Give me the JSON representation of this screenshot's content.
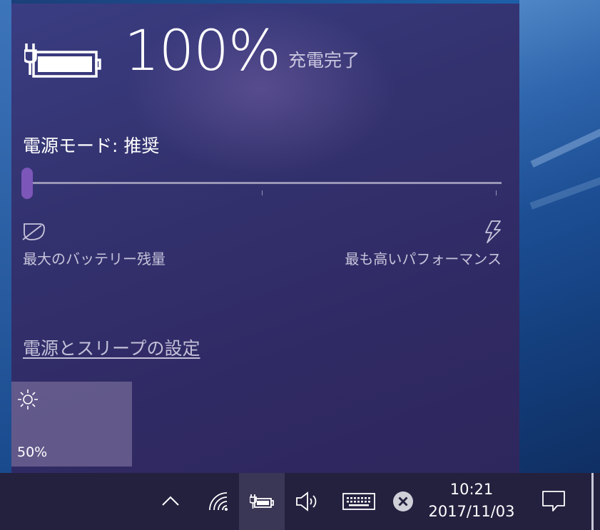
{
  "battery": {
    "percent_text": "100%",
    "status_text": "充電完了",
    "level": 1.0,
    "icon": "battery-charging-icon"
  },
  "power_mode": {
    "label": "電源モード: 推奨",
    "slider_position": 0,
    "left_icon": "leaf-icon",
    "left_label": "最大のバッテリー残量",
    "right_icon": "lightning-bolt-icon",
    "right_label": "最も高いパフォーマンス"
  },
  "settings_link": "電源とスリープの設定",
  "brightness_tile": {
    "icon": "sun-icon",
    "value": "50%"
  },
  "taskbar": {
    "icons": [
      "chevron-up-icon",
      "wifi-icon",
      "battery-plug-icon",
      "speaker-icon",
      "keyboard-icon",
      "close-circle-icon",
      "action-center-icon"
    ],
    "time": "10:21",
    "date": "2017/11/03"
  },
  "colors": {
    "flyout_bg": "#33326f",
    "slider_thumb": "#7c56b8",
    "taskbar_bg": "#24213f"
  }
}
